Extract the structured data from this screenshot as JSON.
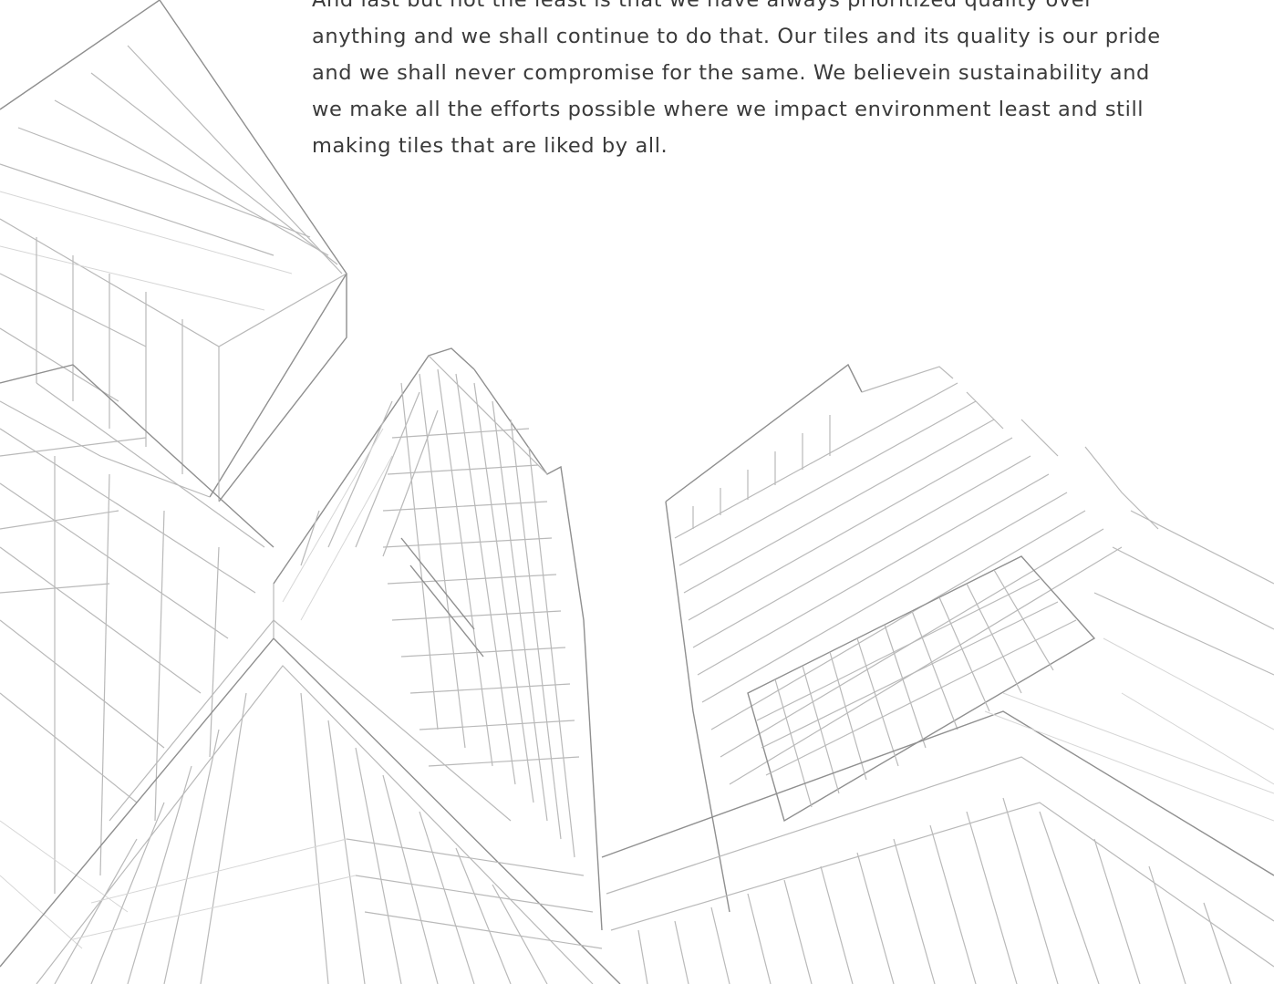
{
  "about": {
    "paragraph_lines": [
      "And last but not the least is that we have always prioritized quality over",
      "anything and we shall continue to do that. Our tiles and its quality is our pride",
      "and we shall never compromise for the same. We believein sustainability and",
      "we make all the efforts possible where we impact environment least and still",
      "making tiles that are liked by all."
    ]
  },
  "background": {
    "illustration": "architectural-line-sketch-of-skyscrapers"
  }
}
